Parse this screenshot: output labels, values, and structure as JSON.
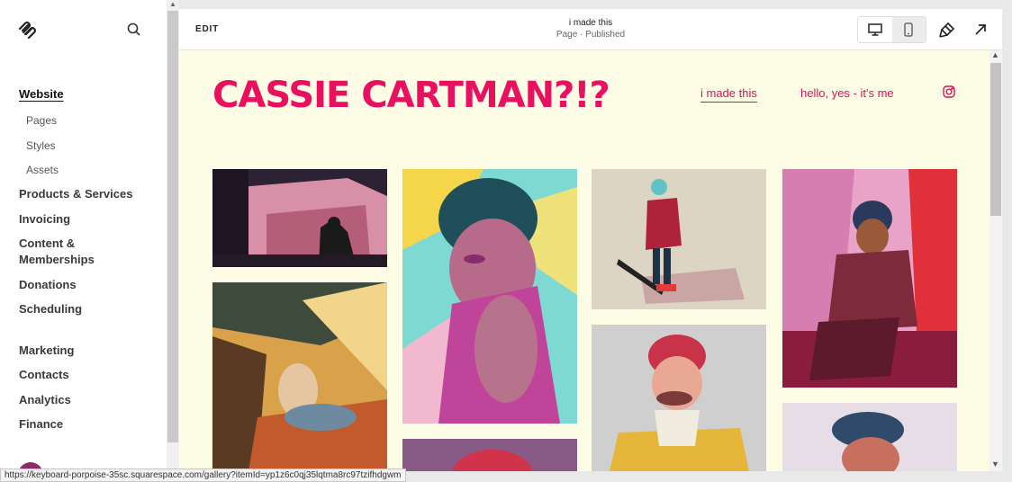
{
  "sidebar": {
    "items": [
      {
        "label": "Website"
      },
      {
        "label": "Pages"
      },
      {
        "label": "Styles"
      },
      {
        "label": "Assets"
      },
      {
        "label": "Products & Services"
      },
      {
        "label": "Invoicing"
      },
      {
        "label": "Content &"
      },
      {
        "label": "Memberships"
      },
      {
        "label": "Donations"
      },
      {
        "label": "Scheduling"
      },
      {
        "label": "Marketing"
      },
      {
        "label": "Contacts"
      },
      {
        "label": "Analytics"
      },
      {
        "label": "Finance"
      }
    ],
    "logo_icon": "squarespace-logo-icon",
    "search_icon": "search-icon"
  },
  "topbar": {
    "edit_label": "EDIT",
    "page_title": "i made this",
    "page_status": "Page · Published",
    "icons": [
      "desktop-icon",
      "mobile-icon",
      "brush-icon",
      "external-arrow-icon"
    ]
  },
  "site": {
    "title": "CASSIE CARTMAN?!?",
    "nav": [
      {
        "label": "i made this"
      },
      {
        "label": "hello, yes - it's me"
      }
    ],
    "accent": "#e8105f",
    "background": "#fdfde6"
  },
  "status_url": "https://keyboard-porpoise-35sc.squarespace.com/gallery?itemId=yp1z6c0qj35lqtma8rc97tzifhdgwm"
}
